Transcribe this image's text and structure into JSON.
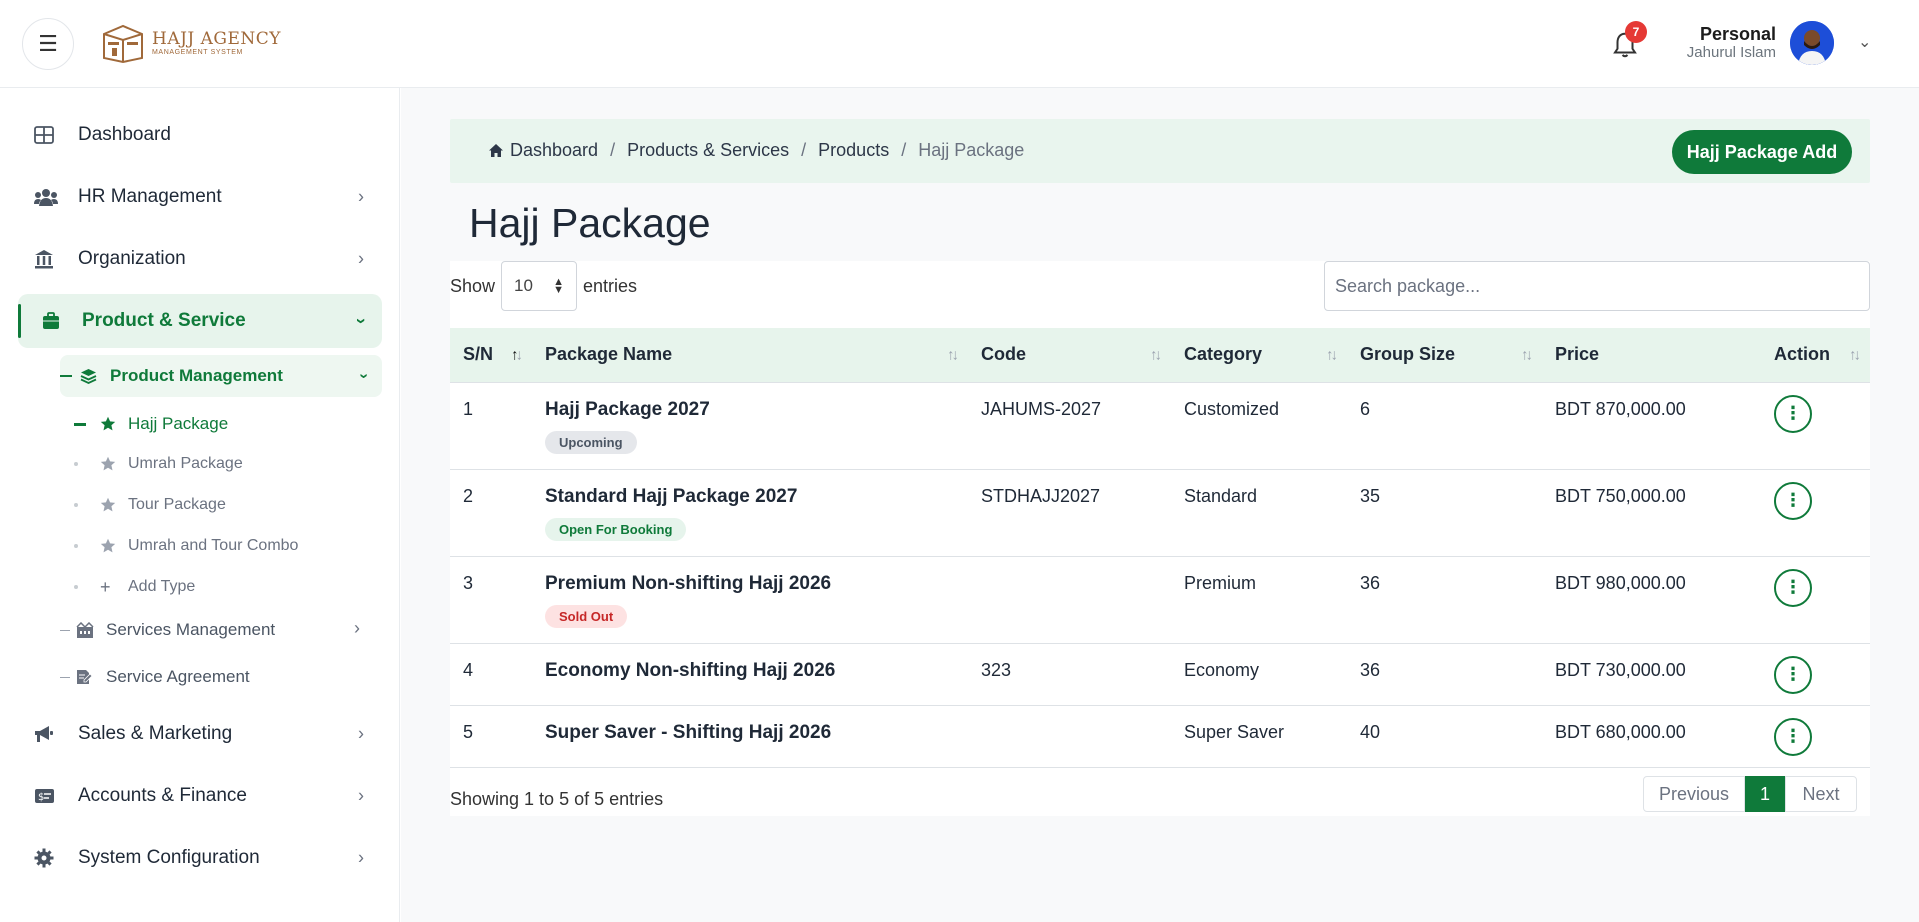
{
  "header": {
    "logo_title": "HAJJ AGENCY",
    "logo_subtitle": "MANAGEMENT SYSTEM",
    "notification_count": "7",
    "user_role": "Personal",
    "user_name": "Jahurul Islam"
  },
  "sidebar": {
    "dashboard": "Dashboard",
    "hr": "HR Management",
    "organization": "Organization",
    "product_service": "Product & Service",
    "product_management": "Product Management",
    "hajj_package": "Hajj Package",
    "umrah_package": "Umrah Package",
    "tour_package": "Tour Package",
    "umrah_tour_combo": "Umrah and Tour Combo",
    "add_type": "Add Type",
    "services_management": "Services Management",
    "service_agreement": "Service Agreement",
    "sales_marketing": "Sales & Marketing",
    "accounts_finance": "Accounts & Finance",
    "system_configuration": "System Configuration"
  },
  "breadcrumb": {
    "home": "Dashboard",
    "level1": "Products & Services",
    "level2": "Products",
    "current": "Hajj Package",
    "separator": "/"
  },
  "actions": {
    "add_label": "Hajj Package Add"
  },
  "page": {
    "title": "Hajj Package"
  },
  "table_controls": {
    "show_label": "Show",
    "entries_value": "10",
    "entries_label": "entries",
    "search_placeholder": "Search package..."
  },
  "table": {
    "columns": [
      "S/N",
      "Package Name",
      "Code",
      "Category",
      "Group Size",
      "Price",
      "Action"
    ],
    "rows": [
      {
        "sn": "1",
        "name": "Hajj Package 2027",
        "status": "Upcoming",
        "code": "JAHUMS-2027",
        "category": "Customized",
        "group_size": "6",
        "price": "BDT 870,000.00"
      },
      {
        "sn": "2",
        "name": "Standard Hajj Package 2027",
        "status": "Open For Booking",
        "code": "STDHAJJ2027",
        "category": "Standard",
        "group_size": "35",
        "price": "BDT 750,000.00"
      },
      {
        "sn": "3",
        "name": "Premium Non-shifting Hajj 2026",
        "status": "Sold Out",
        "code": "",
        "category": "Premium",
        "group_size": "36",
        "price": "BDT 980,000.00"
      },
      {
        "sn": "4",
        "name": "Economy Non-shifting Hajj 2026",
        "status": "",
        "code": "323",
        "category": "Economy",
        "group_size": "36",
        "price": "BDT 730,000.00"
      },
      {
        "sn": "5",
        "name": "Super Saver - Shifting Hajj 2026",
        "status": "",
        "code": "",
        "category": "Super Saver",
        "group_size": "40",
        "price": "BDT 680,000.00"
      }
    ]
  },
  "pagination": {
    "info": "Showing 1 to 5 of 5 entries",
    "previous": "Previous",
    "current_page": "1",
    "next": "Next"
  },
  "colors": {
    "brand_green": "#0f7a3a",
    "light_green": "#e7f4ec",
    "logo_brown": "#a0693a",
    "badge_red": "#e53935"
  },
  "icons": {
    "menu": "hamburger-icon",
    "bell": "bell-icon",
    "dashboard": "grid-icon",
    "hr": "users-icon",
    "organization": "bank-icon",
    "product": "briefcase-icon",
    "product_management": "layers-icon",
    "package": "star-icon",
    "add_type": "plus-icon",
    "services": "building-icon",
    "agreement": "document-icon",
    "sales": "megaphone-icon",
    "accounts": "money-card-icon",
    "system": "gear-icon",
    "row_action": "vertical-dots-icon"
  }
}
